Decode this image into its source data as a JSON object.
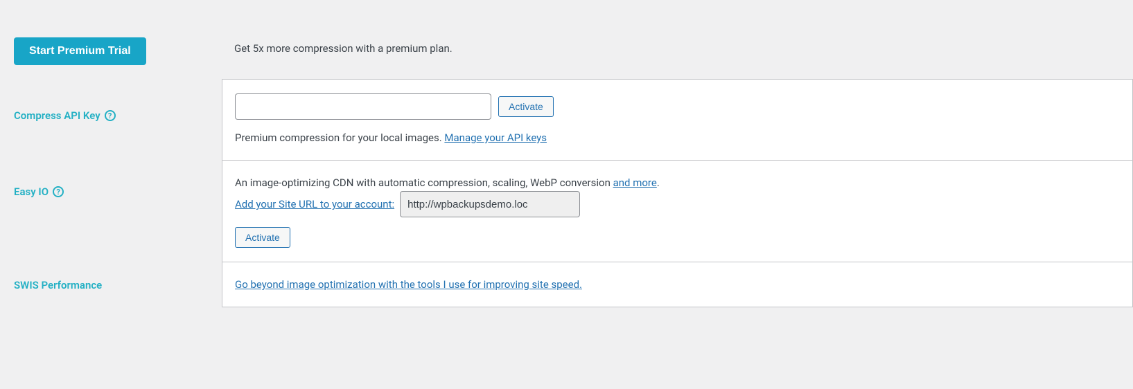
{
  "premium": {
    "button_label": "Start Premium Trial",
    "description": "Get 5x more compression with a premium plan."
  },
  "compress_api": {
    "label": "Compress API Key",
    "input_value": "",
    "input_placeholder": "",
    "activate_label": "Activate",
    "desc_prefix": "Premium compression for your local images. ",
    "manage_link": "Manage your API keys"
  },
  "easy_io": {
    "label": "Easy IO",
    "desc_prefix": "An image-optimizing CDN with automatic compression, scaling, WebP conversion ",
    "and_more_link": "and more",
    "desc_suffix": ".",
    "add_url_link": "Add your Site URL to your account:",
    "site_url_value": "http://wpbackupsdemo.loc",
    "activate_label": "Activate"
  },
  "swis": {
    "label": "SWIS Performance",
    "link_text": "Go beyond image optimization with the tools I use for improving site speed."
  }
}
